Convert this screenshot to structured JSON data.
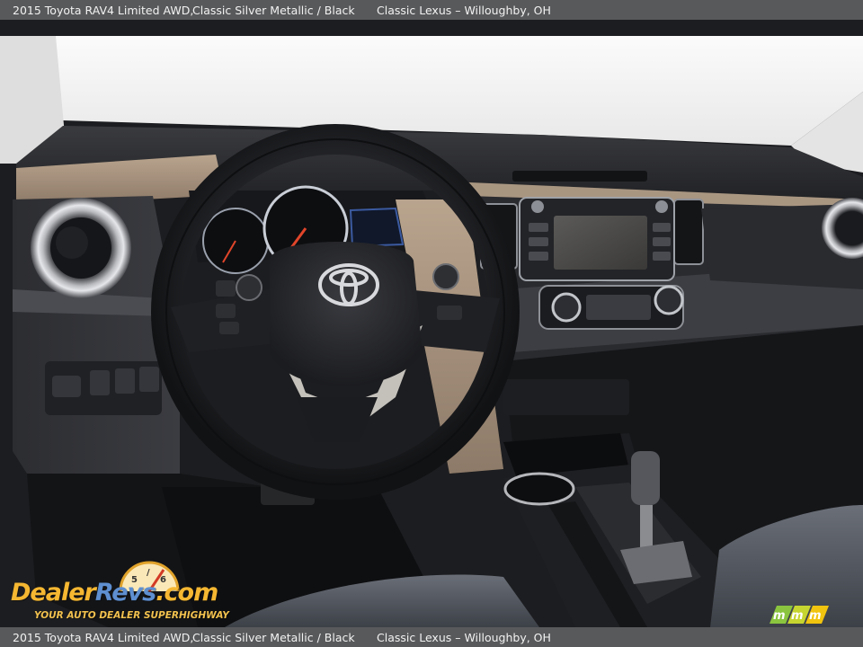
{
  "caption": {
    "vehicle": "2015 Toyota RAV4 Limited AWD,",
    "color": "Classic Silver Metallic / Black",
    "dealer": "Classic Lexus – Willoughby, OH"
  },
  "watermark": {
    "logo_text": "DealerRevs.com",
    "tagline": "YOUR AUTO DEALER SUPERHIGHWAY",
    "brand_color": "#f5b731"
  },
  "corner_logo": {
    "text": "mmm",
    "color": "#8bc53f"
  },
  "photo": {
    "subject": "car interior dashboard",
    "steering_wheel_badge": "toyota-logo"
  }
}
